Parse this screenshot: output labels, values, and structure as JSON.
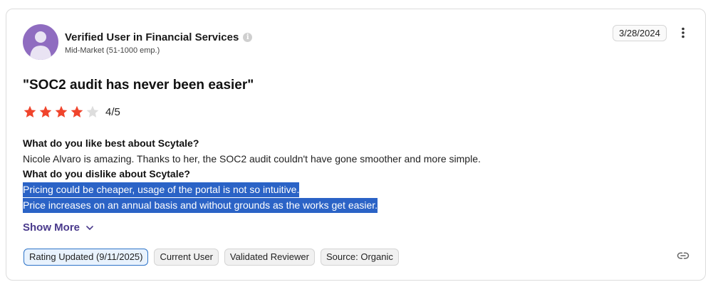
{
  "reviewer": {
    "name": "Verified User in Financial Services",
    "segment": "Mid-Market (51-1000 emp.)",
    "avatar_color": "#8f6cc0"
  },
  "date": "3/28/2024",
  "review": {
    "title": "\"SOC2 audit has never been easier\"",
    "rating": 4,
    "rating_max": 5,
    "rating_text": "4/5",
    "star_color": "#f0442c",
    "like_question": "What do you like best about Scytale?",
    "like_answer": "Nicole Alvaro is amazing. Thanks to her, the SOC2 audit couldn't have gone smoother and more simple.",
    "dislike_question": "What do you dislike about Scytale?",
    "dislike_answer_line1": "Pricing could be cheaper, usage of the portal is not so intuitive.",
    "dislike_answer_line2": "Price increases on an annual basis and without grounds as the works get easier."
  },
  "show_more_label": "Show More",
  "tags": [
    "Rating Updated (9/11/2025)",
    "Current User",
    "Validated Reviewer",
    "Source: Organic"
  ],
  "icons": {
    "info": "info-icon",
    "more": "more-vertical-icon",
    "chevron": "chevron-down-icon",
    "link": "link-icon"
  }
}
